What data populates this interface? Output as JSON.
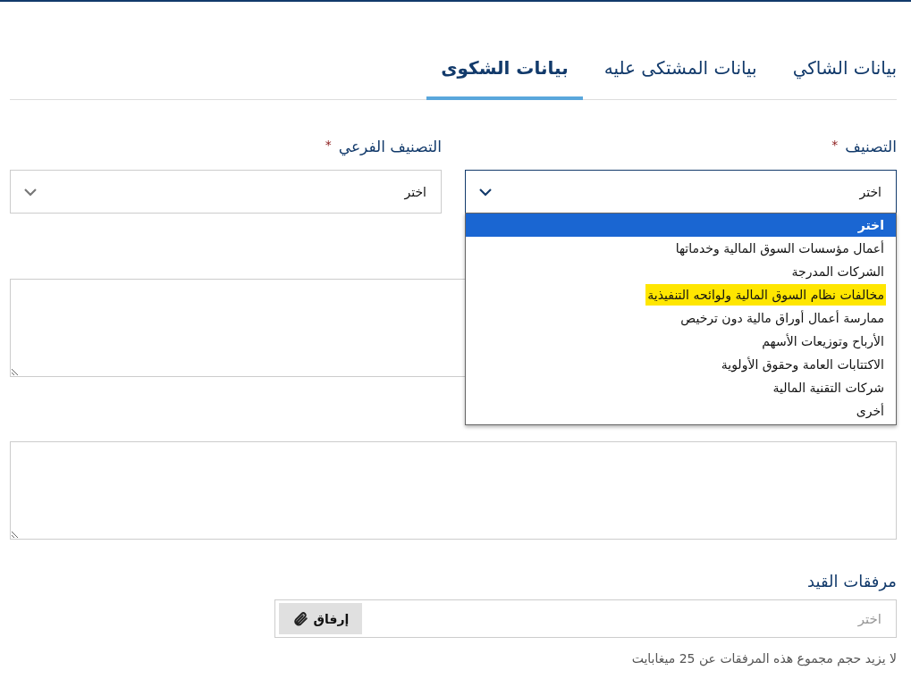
{
  "tabs": [
    {
      "label": "بيانات الشاكي",
      "selected": false
    },
    {
      "label": "بيانات المشتكى عليه",
      "selected": false
    },
    {
      "label": "بيانات الشكوى",
      "selected": true
    }
  ],
  "category": {
    "label": "التصنيف",
    "required_mark": "*",
    "value": "اختر",
    "open": true,
    "options": [
      {
        "label": "اختر",
        "selected": true,
        "highlighted": false
      },
      {
        "label": "أعمال مؤسسات السوق المالية وخدماتها",
        "selected": false,
        "highlighted": false
      },
      {
        "label": "الشركات المدرجة",
        "selected": false,
        "highlighted": false
      },
      {
        "label": "مخالفات نظام السوق المالية ولوائحه التنفيذية",
        "selected": false,
        "highlighted": true
      },
      {
        "label": "ممارسة أعمال أوراق مالية دون ترخيص",
        "selected": false,
        "highlighted": false
      },
      {
        "label": "الأرباح وتوزيعات الأسهم",
        "selected": false,
        "highlighted": false
      },
      {
        "label": "الاكتتابات العامة وحقوق الأولوية",
        "selected": false,
        "highlighted": false
      },
      {
        "label": "شركات التقنية المالية",
        "selected": false,
        "highlighted": false
      },
      {
        "label": "أخرى",
        "selected": false,
        "highlighted": false
      }
    ]
  },
  "subcategory": {
    "label": "التصنيف الفرعي",
    "required_mark": "*",
    "value": "اختر",
    "open": false
  },
  "attachments": {
    "label": "مرفقات القيد",
    "placeholder": "اختر",
    "button": "إرفاق",
    "hint": "لا يزيد حجم مجموع هذه المرفقات عن 25 ميغابايت"
  }
}
